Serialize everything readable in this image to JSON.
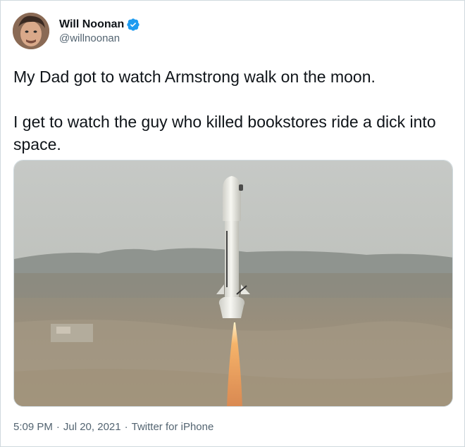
{
  "author": {
    "display_name": "Will Noonan",
    "handle": "@willnoonan",
    "verified": true,
    "avatar_icon": "avatar-photo"
  },
  "tweet": {
    "line1": "My Dad got to watch Armstrong walk on the moon.",
    "line2": "I get to watch the guy who killed bookstores ride a dick into space."
  },
  "media": {
    "type": "photo",
    "subject": "rocket-launch"
  },
  "meta": {
    "time": "5:09 PM",
    "sep1": "·",
    "date": "Jul 20, 2021",
    "sep2": "·",
    "source": "Twitter for iPhone"
  },
  "colors": {
    "verified_blue": "#1d9bf0",
    "secondary_text": "#536471",
    "border": "#cfd9de"
  }
}
